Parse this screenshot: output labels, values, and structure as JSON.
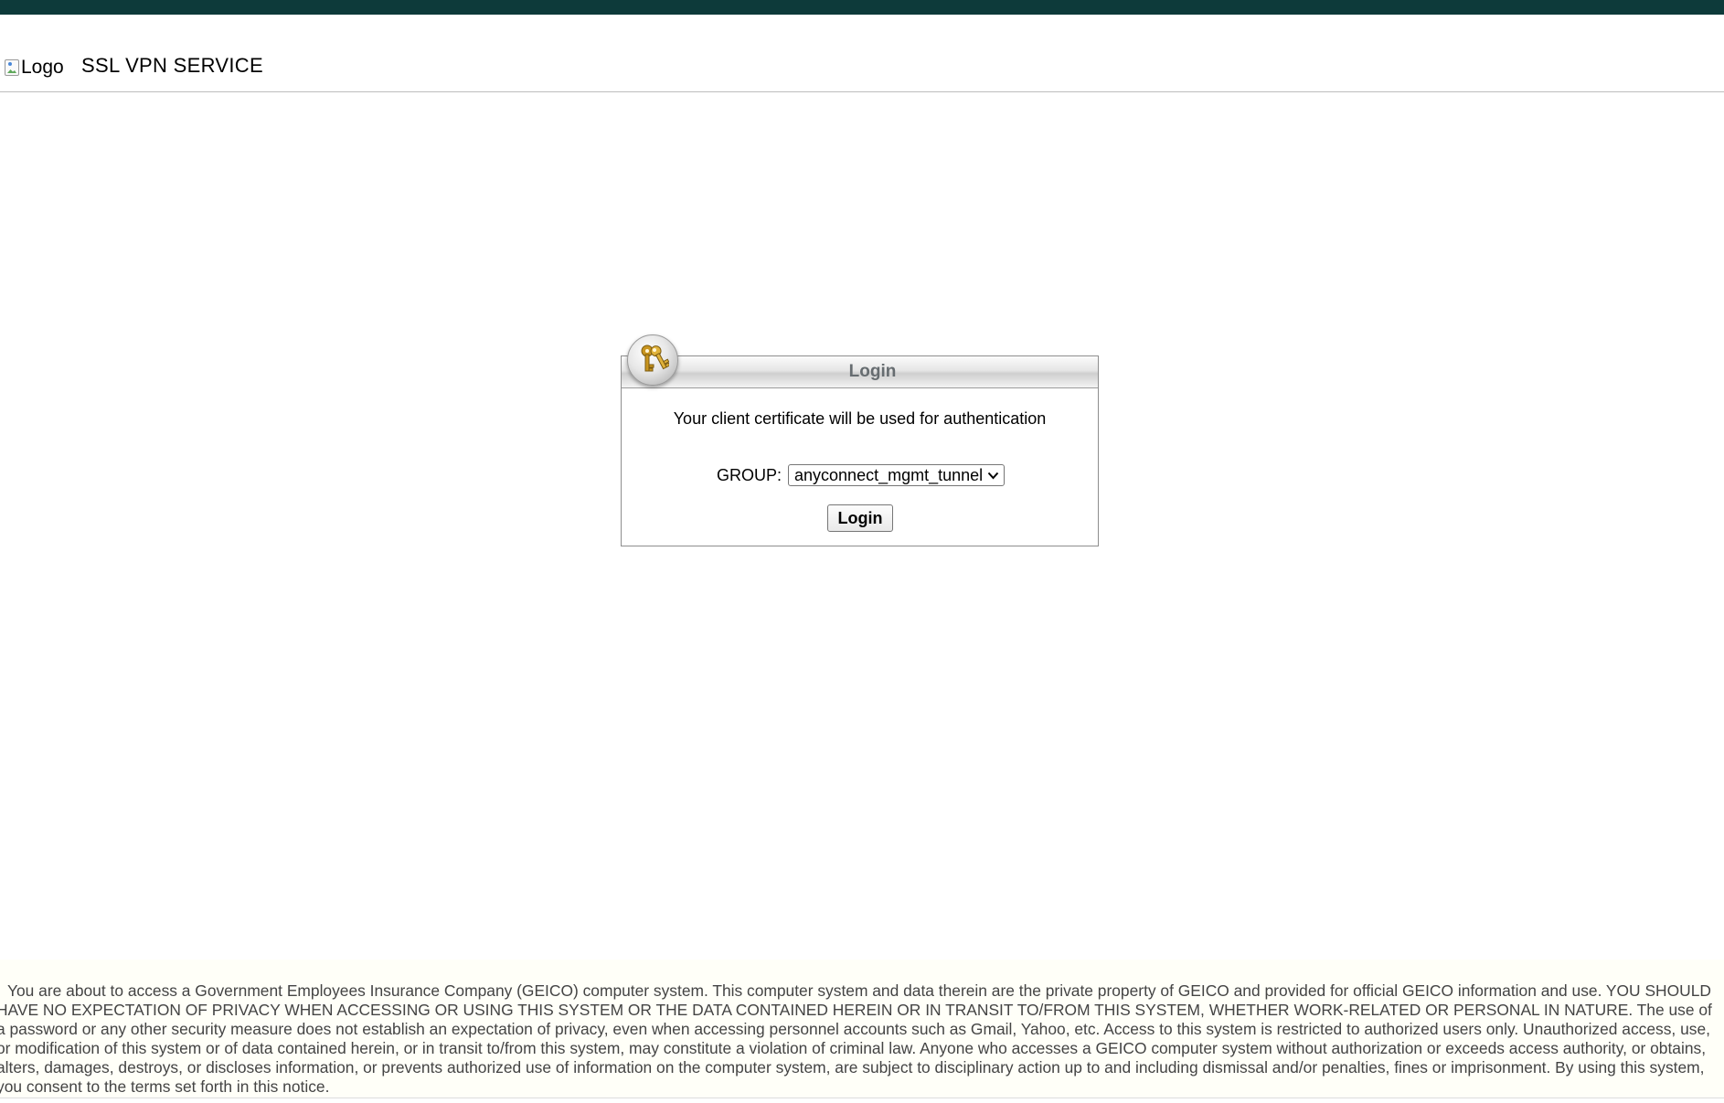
{
  "header": {
    "logo_alt": "Logo",
    "title": "SSL VPN SERVICE"
  },
  "login": {
    "title": "Login",
    "message": "Your client certificate will be used for authentication",
    "group_label": "GROUP:",
    "group_selected": "anyconnect_mgmt_tunnel",
    "button_label": "Login"
  },
  "icons": {
    "login_badge": "keys-icon",
    "select_arrow": "chevron-down-icon",
    "broken_image": "broken-image-icon"
  },
  "colors": {
    "top_bar": "#0d3a3a",
    "login_title": "#666c70",
    "disclaimer_text": "#444444",
    "disclaimer_bg": "#fffff8"
  },
  "disclaimer": {
    "text": "You are about to access a Government Employees Insurance Company (GEICO) computer system. This computer system and data therein are the private property of GEICO and provided for official GEICO information and use. YOU SHOULD HAVE NO EXPECTATION OF PRIVACY WHEN ACCESSING OR USING THIS SYSTEM OR THE DATA CONTAINED HEREIN OR IN TRANSIT TO/FROM THIS SYSTEM, WHETHER WORK-RELATED OR PERSONAL IN NATURE. The use of a password or any other security measure does not establish an expectation of privacy, even when accessing personnel accounts such as Gmail, Yahoo, etc. Access to this system is restricted to authorized users only. Unauthorized access, use, or modification of this system or of data contained herein, or in transit to/from this system, may constitute a violation of criminal law. Anyone who accesses a GEICO computer system without authorization or exceeds access authority, or obtains, alters, damages, destroys, or discloses information, or prevents authorized use of information on the computer system, are subject to disciplinary action up to and including dismissal and/or penalties, fines or imprisonment. By using this system, you consent to the terms set forth in this notice."
  }
}
